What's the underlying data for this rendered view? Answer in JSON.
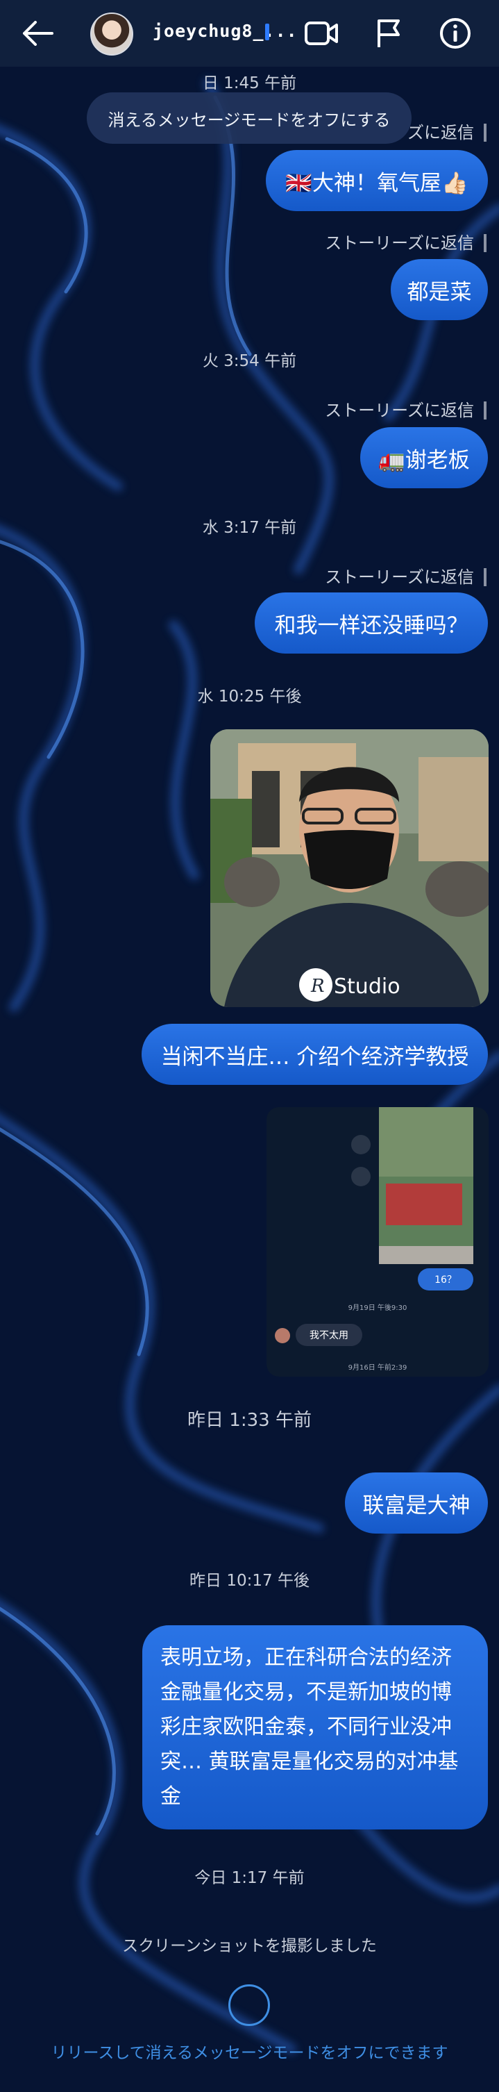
{
  "header": {
    "username": "joeychug8_...",
    "icons": [
      "back-arrow-icon",
      "video-call-icon",
      "flag-icon",
      "info-icon"
    ]
  },
  "pill_text": "消えるメッセージモードをオフにする",
  "messages": {
    "ts1": "日 1:45 午前",
    "story1": "ズに返信",
    "bubble1": "🇬🇧大神！氧气屋👍🏻",
    "story2": "ストーリーズに返信",
    "bubble2": "都是菜",
    "ts2": "火 3:54 午前",
    "story3": "ストーリーズに返信",
    "bubble3": "🚛谢老板",
    "ts3": "水 3:17 午前",
    "story4": "ストーリーズに返信",
    "bubble4": "和我一样还没睡吗？",
    "ts4": "水 10:25 午後",
    "photo_logo": "Studio",
    "photo_logo_r": "R",
    "bubble5": "当闲不当庄… 介绍个经济学教授",
    "shot_badge": "16？",
    "shot_ts1": "9月19日 午後9:30",
    "shot_msg": "我不太用",
    "shot_ts2": "9月16日 午前2:39",
    "ts5": "昨日 1:33 午前",
    "bubble6": "联富是大神",
    "ts6": "昨日 10:17 午後",
    "bubble7_lines": [
      "表明立场，正在科研合法的经济",
      "金融量化交易，不是新加坡的博",
      "彩庄家欧阳金泰，不同行业没冲",
      "突… 黄联富是量化交易的对冲基",
      "金"
    ],
    "ts7": "今日 1:17 午前",
    "screenshot_notice": "スクリーンショットを撮影しました",
    "bottom_hint": "リリースして消えるメッセージモードをオフにできます"
  },
  "colors": {
    "background": "#061433",
    "header": "#10203d",
    "bubble": "#1f66d8",
    "accent": "#3f8fe4"
  }
}
